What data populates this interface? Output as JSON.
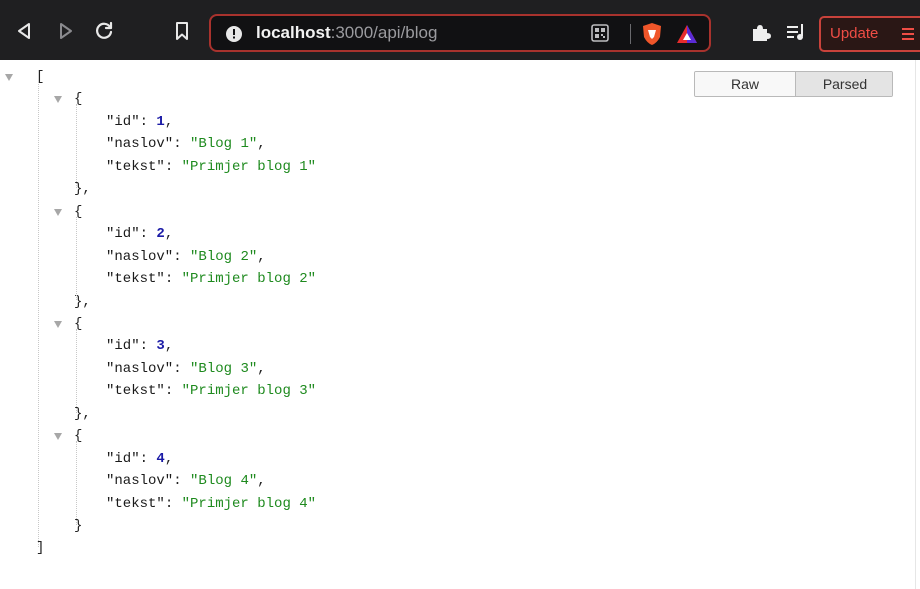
{
  "browser": {
    "url_host": "localhost",
    "url_path": ":3000/api/blog",
    "update_label": "Update",
    "icons": {
      "back": "back-arrow-icon",
      "forward": "forward-arrow-icon",
      "reload": "reload-icon",
      "bookmark": "bookmark-icon",
      "site_info": "info-icon",
      "qr": "qr-code-icon",
      "brave_shield": "brave-shield-icon",
      "rewards": "brave-rewards-icon",
      "extensions": "puzzle-icon",
      "playlist": "playlist-icon",
      "menu": "hamburger-menu-icon"
    },
    "colors": {
      "toolbar_bg": "#1f1f21",
      "urlbar_border": "#a8322d",
      "update_accent": "#ef4d45"
    }
  },
  "viewer": {
    "tabs": [
      "Raw",
      "Parsed"
    ],
    "active_tab": "Parsed",
    "open_bracket": "[",
    "close_bracket": "]",
    "items": [
      {
        "id": "1",
        "naslov": "\"Blog 1\"",
        "tekst": "\"Primjer blog 1\"",
        "close": "},"
      },
      {
        "id": "2",
        "naslov": "\"Blog 2\"",
        "tekst": "\"Primjer blog 2\"",
        "close": "},"
      },
      {
        "id": "3",
        "naslov": "\"Blog 3\"",
        "tekst": "\"Primjer blog 3\"",
        "close": "},"
      },
      {
        "id": "4",
        "naslov": "\"Blog 4\"",
        "tekst": "\"Primjer blog 4\"",
        "close": "}"
      }
    ],
    "key_id": "\"id\"",
    "key_naslov": "\"naslov\"",
    "key_tekst": "\"tekst\"",
    "colon": ": ",
    "comma": ",",
    "open_brace": "{",
    "colors": {
      "number": "#1a1aa6",
      "string": "#1e8a1e",
      "key": "#1a1a1a"
    }
  }
}
